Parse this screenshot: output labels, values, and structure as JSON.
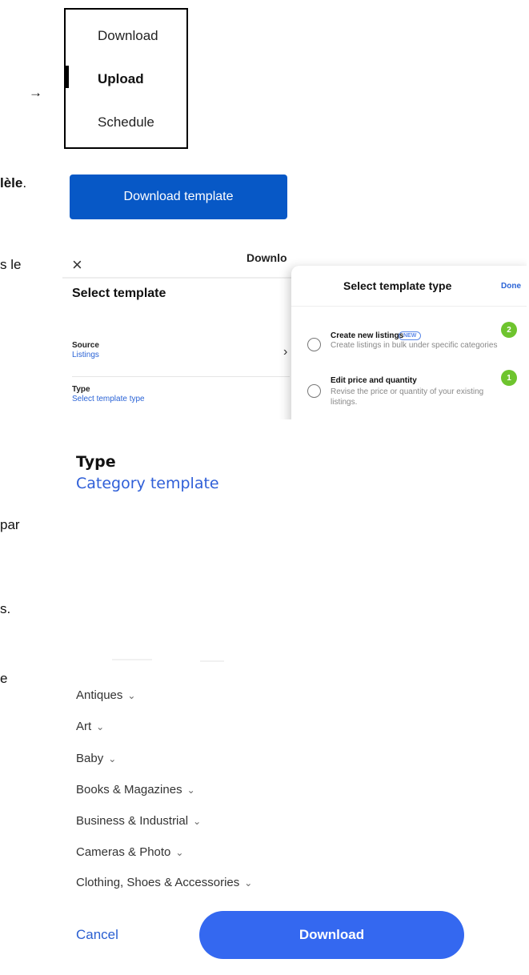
{
  "fragments": {
    "arrow": "→",
    "model_suffix": "lèle",
    "model_period": ".",
    "le": "s le",
    "par": "par",
    "s_period": "s.",
    "e": "e"
  },
  "menu": {
    "items": [
      "Download",
      "Upload",
      "Schedule"
    ],
    "active": "Upload"
  },
  "download_template_button": "Download template",
  "modal": {
    "close": "×",
    "title": "Downlo",
    "select_template_heading": "Select template",
    "source_label": "Source",
    "source_value": "Listings",
    "type_label": "Type",
    "type_value": "Select template type",
    "chevron": "›",
    "panel": {
      "title": "Select template type",
      "done": "Done",
      "options": [
        {
          "title": "Create new listings",
          "badge": "NEW",
          "description": "Create listings in bulk under specific categories",
          "number": "2"
        },
        {
          "title": "Edit price and quantity",
          "description": "Revise the price or quantity of your existing listings.",
          "number": "1"
        }
      ]
    }
  },
  "type_block": {
    "heading": "Type",
    "value": "Category template"
  },
  "categories": [
    "Antiques",
    "Art",
    "Baby",
    "Books & Magazines",
    "Business & Industrial",
    "Cameras & Photo",
    "Clothing, Shoes & Accessories"
  ],
  "actions": {
    "cancel": "Cancel",
    "download": "Download"
  },
  "colors": {
    "primary_button": "#0758c6",
    "download_button": "#3468f0",
    "link": "#2a63d6",
    "badge_green": "#6ec42e"
  }
}
